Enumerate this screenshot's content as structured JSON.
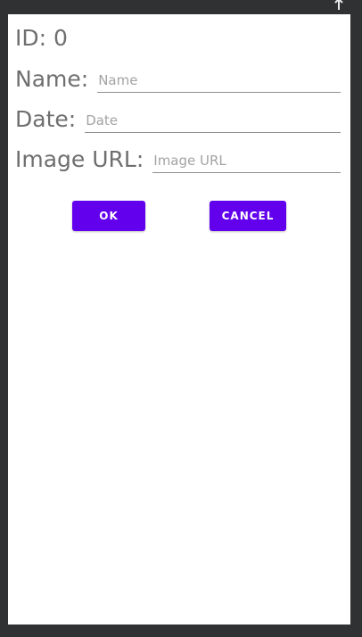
{
  "status_bar": {
    "icon": "notification-icon"
  },
  "form": {
    "id_label": "ID: 0",
    "name_label": "Name:",
    "name_value": "",
    "name_placeholder": "Name",
    "date_label": "Date:",
    "date_value": "",
    "date_placeholder": "Date",
    "image_url_label": "Image URL:",
    "image_url_value": "",
    "image_url_placeholder": "Image URL"
  },
  "actions": {
    "ok_label": "OK",
    "cancel_label": "CANCEL"
  },
  "colors": {
    "accent": "#6200ee",
    "background": "#2f3133",
    "label_text": "#6f6f6f"
  }
}
